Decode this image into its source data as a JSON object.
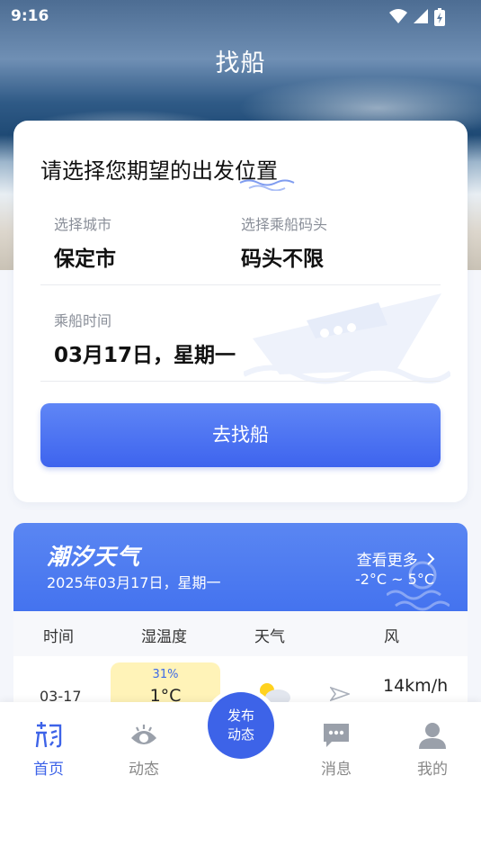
{
  "status_bar": {
    "time": "9:16"
  },
  "header": {
    "title": "找船"
  },
  "search_card": {
    "heading": "请选择您期望的出发位置",
    "city_label": "选择城市",
    "city_value": "保定市",
    "pier_label": "选择乘船码头",
    "pier_value": "码头不限",
    "time_label": "乘船时间",
    "time_value": "03月17日，星期一",
    "search_button": "去找船"
  },
  "weather": {
    "title": "潮汐天气",
    "date": "2025年03月17日，星期一",
    "more_link": "查看更多",
    "temp_range": "-2°C ~ 5°C",
    "columns": [
      "时间",
      "湿温度",
      "天气",
      "风"
    ],
    "rows": [
      {
        "date": "03-17",
        "humidity": "31%",
        "temp": "1°C",
        "weather_icon": "partly-cloudy-icon",
        "wind_icon": "wind-direction-icon",
        "wind_speed": "14km/h"
      }
    ],
    "chip_color": "#fff3b8"
  },
  "tabbar": {
    "items": [
      {
        "label": "首页",
        "icon": "home-fish-icon",
        "active": true
      },
      {
        "label": "动态",
        "icon": "eye-icon",
        "active": false
      },
      {
        "label": "消息",
        "icon": "chat-icon",
        "active": false
      },
      {
        "label": "我的",
        "icon": "user-icon",
        "active": false
      }
    ],
    "publish_line1": "发布",
    "publish_line2": "动态"
  },
  "colors": {
    "accent": "#3d63e8",
    "weather_header": "#4f7cf0"
  }
}
